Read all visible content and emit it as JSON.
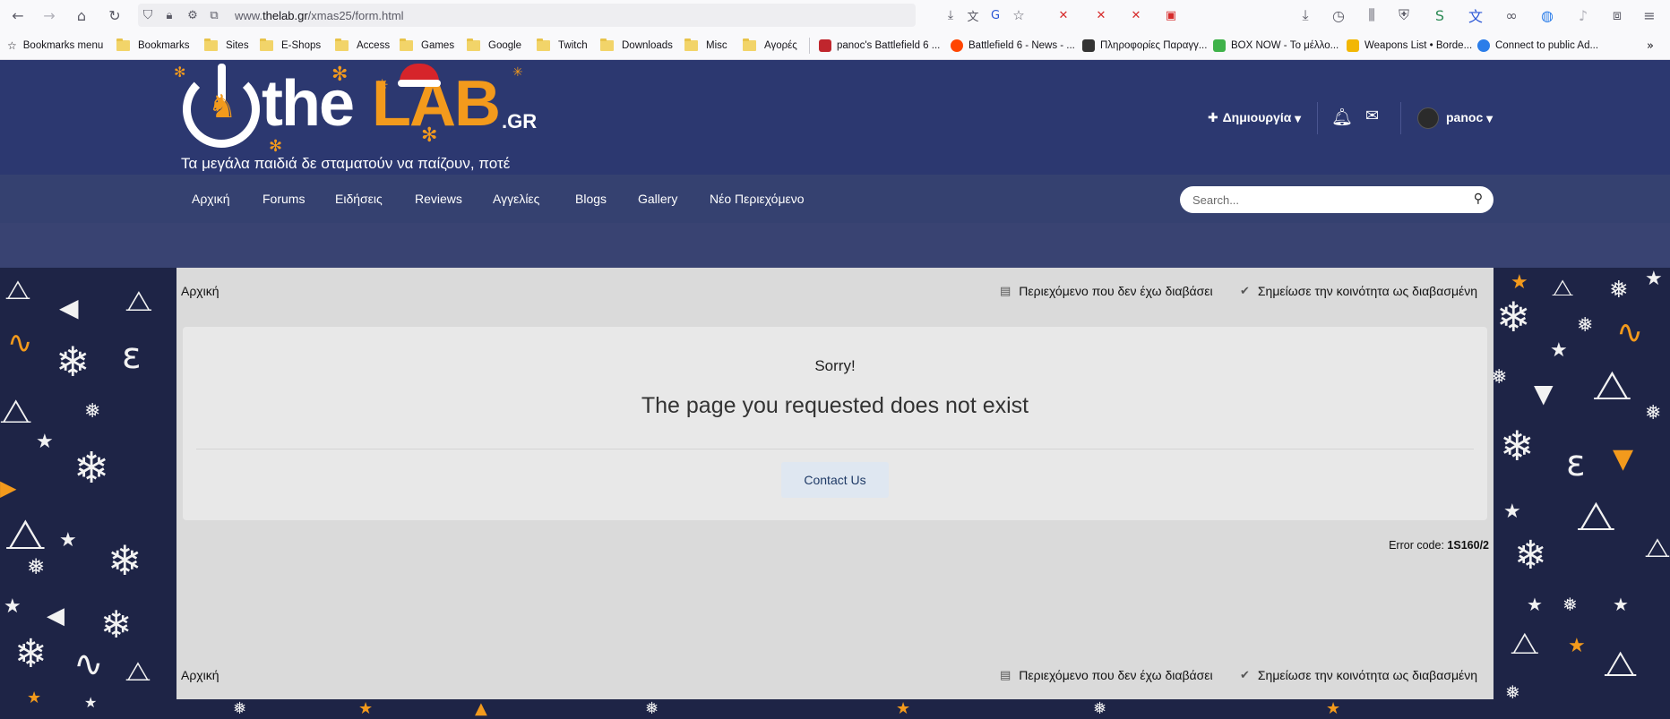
{
  "browser": {
    "url_prefix": "www.",
    "url_domain": "thelab.gr",
    "url_path": "/xmas25/form.html",
    "bookmarks": [
      {
        "label": "Bookmarks menu",
        "type": "menu"
      },
      {
        "label": "Bookmarks",
        "type": "folder"
      },
      {
        "label": "Sites",
        "type": "folder"
      },
      {
        "label": "E-Shops",
        "type": "folder"
      },
      {
        "label": "Access",
        "type": "folder"
      },
      {
        "label": "Games",
        "type": "folder"
      },
      {
        "label": "Google",
        "type": "folder"
      },
      {
        "label": "Twitch",
        "type": "folder"
      },
      {
        "label": "Downloads",
        "type": "folder"
      },
      {
        "label": "Misc",
        "type": "folder"
      },
      {
        "label": "Αγορές",
        "type": "folder"
      },
      {
        "label": "panoc's Battlefield 6 ...",
        "type": "site",
        "color": "#c0262d"
      },
      {
        "label": "Battlefield 6 - News - ...",
        "type": "site",
        "color": "#ff4500"
      },
      {
        "label": "Πληροφορίες Παραγγ...",
        "type": "site",
        "color": "#333333"
      },
      {
        "label": "BOX NOW - Το μέλλο...",
        "type": "site",
        "color": "#3fb24a"
      },
      {
        "label": "Weapons List • Borde...",
        "type": "site",
        "color": "#f2b705"
      },
      {
        "label": "Connect to public Ad...",
        "type": "site",
        "color": "#2b7de9"
      }
    ]
  },
  "header": {
    "logo_the": "the",
    "logo_lab": "LAB",
    "logo_gr": ".GR",
    "slogan": "Τα μεγάλα παιδιά δε σταματούν να παίζουν, ποτέ",
    "create_label": "Δημιουργία",
    "username": "panoc"
  },
  "nav": {
    "items": [
      "Αρχική",
      "Forums",
      "Ειδήσεις",
      "Reviews",
      "Αγγελίες",
      "Blogs",
      "Gallery",
      "Νέο Περιεχόμενο"
    ],
    "search_placeholder": "Search..."
  },
  "breadcrumb": {
    "home": "Αρχική",
    "unread": "Περιεχόμενο που δεν έχω διαβάσει",
    "mark_read": "Σημείωσε την κοινότητα ως διαβασμένη"
  },
  "error": {
    "sorry": "Sorry!",
    "title": "The page you requested does not exist",
    "contact_label": "Contact Us",
    "code_label": "Error code:",
    "code_value": "1S160/2"
  },
  "colors": {
    "header_bg": "#2c3870",
    "nav_bg": "#354170",
    "accent_orange": "#f39a1c",
    "page_bg": "#1e2446",
    "content_bg": "#dadada"
  }
}
